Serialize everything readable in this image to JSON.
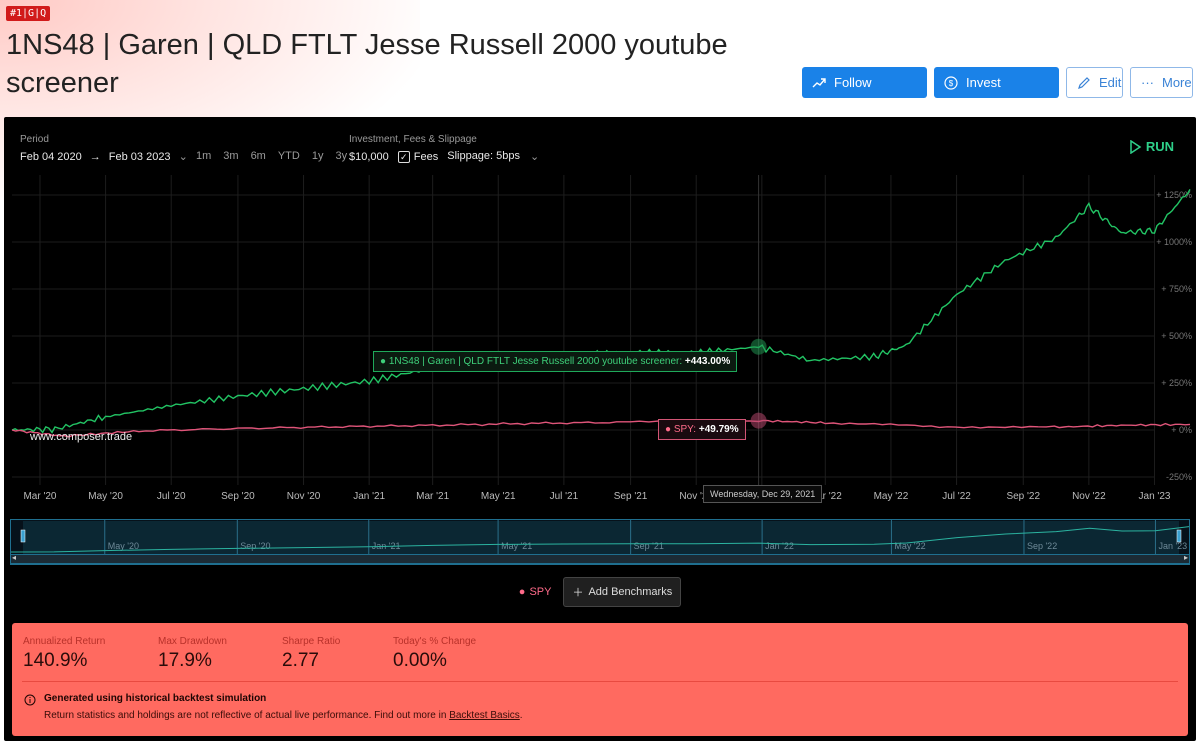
{
  "tag": "#1|G|Q",
  "title": "1NS48 | Garen | QLD FTLT Jesse Russell 2000 youtube screener",
  "actions": {
    "follow": "Follow",
    "invest": "Invest",
    "edit": "Edit",
    "more": "More"
  },
  "controls": {
    "period_label": "Period",
    "period_start": "Feb 04 2020",
    "period_end": "Feb 03 2023",
    "ranges": [
      "1m",
      "3m",
      "6m",
      "YTD",
      "1y",
      "3y"
    ],
    "invest_label": "Investment, Fees & Slippage",
    "investment": "$10,000",
    "fees_label": "Fees",
    "slippage": "Slippage: 5bps",
    "run_label": "RUN"
  },
  "chart_data": {
    "type": "line",
    "x_ticks": [
      "Mar '20",
      "May '20",
      "Jul '20",
      "Sep '20",
      "Nov '20",
      "Jan '21",
      "Mar '21",
      "May '21",
      "Jul '21",
      "Sep '21",
      "Nov '21",
      "Jan '22",
      "Mar '22",
      "May '22",
      "Jul '22",
      "Sep '22",
      "Nov '22",
      "Jan '23"
    ],
    "y_ticks": [
      "1250%",
      "1000%",
      "750%",
      "500%",
      "250%",
      "0%",
      "-250%"
    ],
    "y_values": [
      1250,
      1000,
      750,
      500,
      250,
      0,
      -250
    ],
    "ylim": [
      -250,
      1250
    ],
    "series": [
      {
        "name": "1NS48 | Garen | QLD FTLT Jesse Russell 2000 youtube screener",
        "color": "#22c464",
        "x": [
          "2020-02-04",
          "2020-03-15",
          "2020-05-01",
          "2020-07-01",
          "2020-09-01",
          "2020-11-01",
          "2021-01-01",
          "2021-03-01",
          "2021-05-01",
          "2021-07-01",
          "2021-09-01",
          "2021-11-01",
          "2021-12-29",
          "2022-02-15",
          "2022-04-15",
          "2022-05-15",
          "2022-07-01",
          "2022-08-15",
          "2022-10-01",
          "2022-11-01",
          "2022-12-01",
          "2023-01-01",
          "2023-02-03"
        ],
        "y": [
          0,
          5,
          70,
          130,
          180,
          220,
          260,
          330,
          380,
          400,
          410,
          410,
          443,
          370,
          390,
          450,
          720,
          900,
          1020,
          1190,
          1050,
          1060,
          1280
        ]
      },
      {
        "name": "SPY",
        "color": "#e0557a",
        "x": [
          "2020-02-04",
          "2020-03-23",
          "2020-06-01",
          "2020-09-01",
          "2020-12-01",
          "2021-03-01",
          "2021-06-01",
          "2021-09-01",
          "2021-12-29",
          "2022-03-01",
          "2022-06-15",
          "2022-09-30",
          "2022-12-01",
          "2023-02-03"
        ],
        "y": [
          0,
          -33,
          -5,
          8,
          17,
          25,
          35,
          42,
          49.79,
          38,
          18,
          15,
          25,
          30
        ]
      }
    ],
    "tooltips": {
      "main": "1NS48 | Garen | QLD FTLT Jesse Russell 2000 youtube screener:",
      "main_value": "+443.00%",
      "spy": "SPY:",
      "spy_value": "+49.79%",
      "date": "Wednesday, Dec 29, 2021"
    },
    "navigator_ticks": [
      "May '20",
      "Sep '20",
      "Jan '21",
      "May '21",
      "Sep '21",
      "Jan '22",
      "May '22",
      "Sep '22",
      "Jan '23"
    ],
    "watermark": "www.composer.trade"
  },
  "benchmarks": {
    "spy": "SPY",
    "add": "Add Benchmarks"
  },
  "stats": [
    {
      "label": "Annualized Return",
      "value": "140.9%"
    },
    {
      "label": "Max Drawdown",
      "value": "17.9%"
    },
    {
      "label": "Sharpe Ratio",
      "value": "2.77"
    },
    {
      "label": "Today's % Change",
      "value": "0.00%"
    }
  ],
  "notice": {
    "title": "Generated using historical backtest simulation",
    "body": "Return statistics and holdings are not reflective of actual live performance. Find out more in",
    "link": "Backtest Basics",
    "period": "."
  }
}
